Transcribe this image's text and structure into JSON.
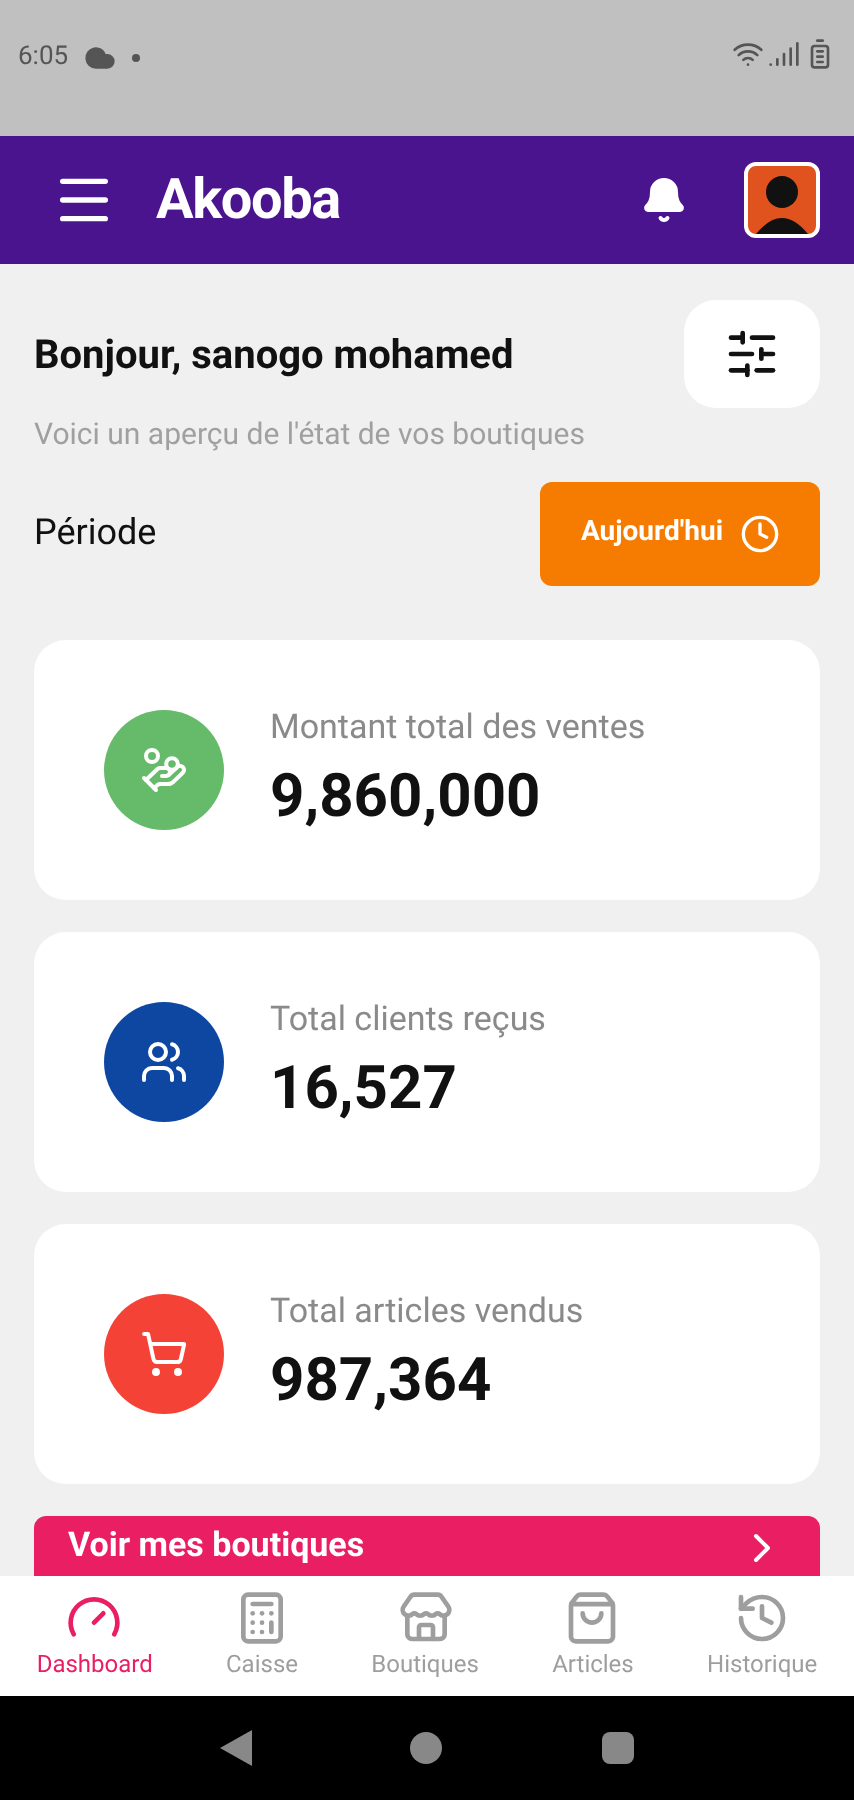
{
  "status_bar": {
    "time": "6:05"
  },
  "header": {
    "logo": "Akooba"
  },
  "greeting": {
    "title": "Bonjour, sanogo mohamed",
    "subtitle": "Voici un aperçu de l'état de vos boutiques"
  },
  "period": {
    "label": "Période",
    "button": "Aujourd'hui"
  },
  "stats": [
    {
      "kind": "sales",
      "label": "Montant total des ventes",
      "value": "9,860,000",
      "color": "#66bb6a"
    },
    {
      "kind": "clients",
      "label": "Total clients reçus",
      "value": "16,527",
      "color": "#0d47a1"
    },
    {
      "kind": "articles",
      "label": "Total articles vendus",
      "value": "987,364",
      "color": "#f44336"
    }
  ],
  "shops_button": {
    "label": "Voir mes boutiques"
  },
  "bottom_nav": [
    {
      "kind": "dashboard",
      "label": "Dashboard",
      "selected": true
    },
    {
      "kind": "caisse",
      "label": "Caisse",
      "selected": false
    },
    {
      "kind": "boutiques",
      "label": "Boutiques",
      "selected": false
    },
    {
      "kind": "articles",
      "label": "Articles",
      "selected": false
    },
    {
      "kind": "historique",
      "label": "Historique",
      "selected": false
    }
  ]
}
